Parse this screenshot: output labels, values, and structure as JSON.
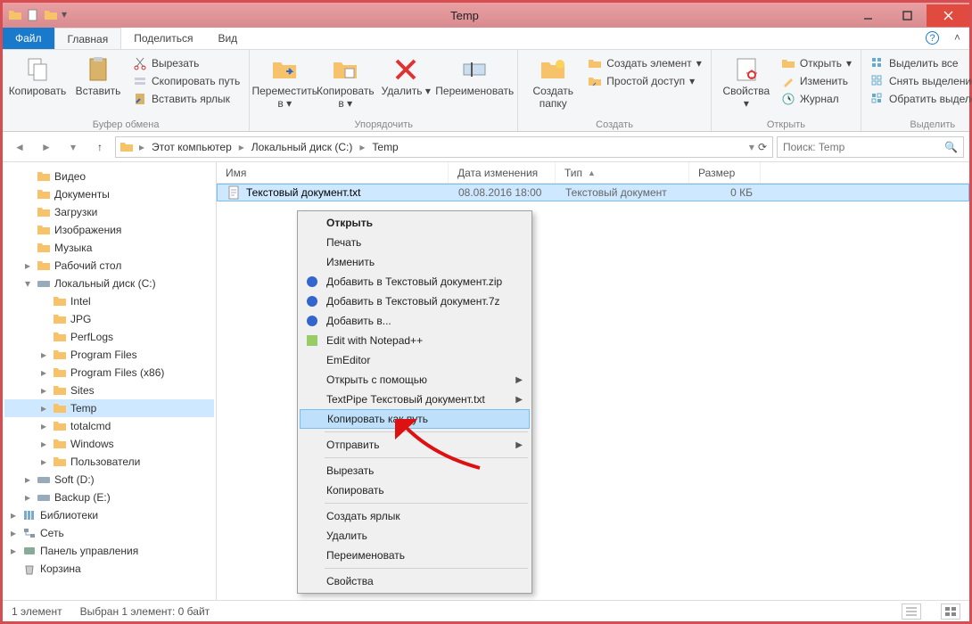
{
  "window": {
    "title": "Temp"
  },
  "tabs": {
    "file": "Файл",
    "home": "Главная",
    "share": "Поделиться",
    "view": "Вид"
  },
  "ribbon": {
    "clipboard": {
      "copy": "Копировать",
      "paste": "Вставить",
      "cut": "Вырезать",
      "copy_path": "Скопировать путь",
      "paste_shortcut": "Вставить ярлык",
      "group": "Буфер обмена"
    },
    "organize": {
      "move_to": "Переместить в",
      "copy_to": "Копировать в",
      "delete": "Удалить",
      "rename": "Переименовать",
      "group": "Упорядочить"
    },
    "new": {
      "new_folder": "Создать папку",
      "new_item": "Создать элемент",
      "easy_access": "Простой доступ",
      "group": "Создать"
    },
    "open": {
      "properties": "Свойства",
      "open": "Открыть",
      "edit": "Изменить",
      "history": "Журнал",
      "group": "Открыть"
    },
    "select": {
      "select_all": "Выделить все",
      "select_none": "Снять выделение",
      "invert": "Обратить выделение",
      "group": "Выделить"
    }
  },
  "breadcrumbs": {
    "this_pc": "Этот компьютер",
    "drive": "Локальный диск (C:)",
    "folder": "Temp"
  },
  "search": {
    "placeholder": "Поиск: Temp"
  },
  "tree": {
    "videos": "Видео",
    "documents": "Документы",
    "downloads": "Загрузки",
    "pictures": "Изображения",
    "music": "Музыка",
    "desktop": "Рабочий стол",
    "drive_c": "Локальный диск (C:)",
    "c_children": [
      "Intel",
      "JPG",
      "PerfLogs",
      "Program Files",
      "Program Files (x86)",
      "Sites",
      "Temp",
      "totalcmd",
      "Windows",
      "Пользователи"
    ],
    "soft_d": "Soft (D:)",
    "backup_e": "Backup (E:)",
    "libraries": "Библиотеки",
    "network": "Сеть",
    "control_panel": "Панель управления",
    "recycle": "Корзина"
  },
  "columns": {
    "name": "Имя",
    "date": "Дата изменения",
    "type": "Тип",
    "size": "Размер"
  },
  "files": [
    {
      "name": "Текстовый документ.txt",
      "date": "08.08.2016 18:00",
      "type": "Текстовый документ",
      "size": "0 КБ"
    }
  ],
  "context_menu": {
    "open": "Открыть",
    "print": "Печать",
    "edit": "Изменить",
    "add_zip": "Добавить в Текстовый документ.zip",
    "add_7z": "Добавить в Текстовый документ.7z",
    "add_to": "Добавить в...",
    "edit_npp": "Edit with Notepad++",
    "emeditor": "EmEditor",
    "open_with": "Открыть с помощью",
    "textpipe": "TextPipe Текстовый документ.txt",
    "copy_as_path": "Копировать как путь",
    "send_to": "Отправить",
    "cut": "Вырезать",
    "copy": "Копировать",
    "create_shortcut": "Создать ярлык",
    "delete": "Удалить",
    "rename": "Переименовать",
    "properties": "Свойства"
  },
  "status": {
    "count": "1 элемент",
    "selected": "Выбран 1 элемент: 0 байт"
  }
}
